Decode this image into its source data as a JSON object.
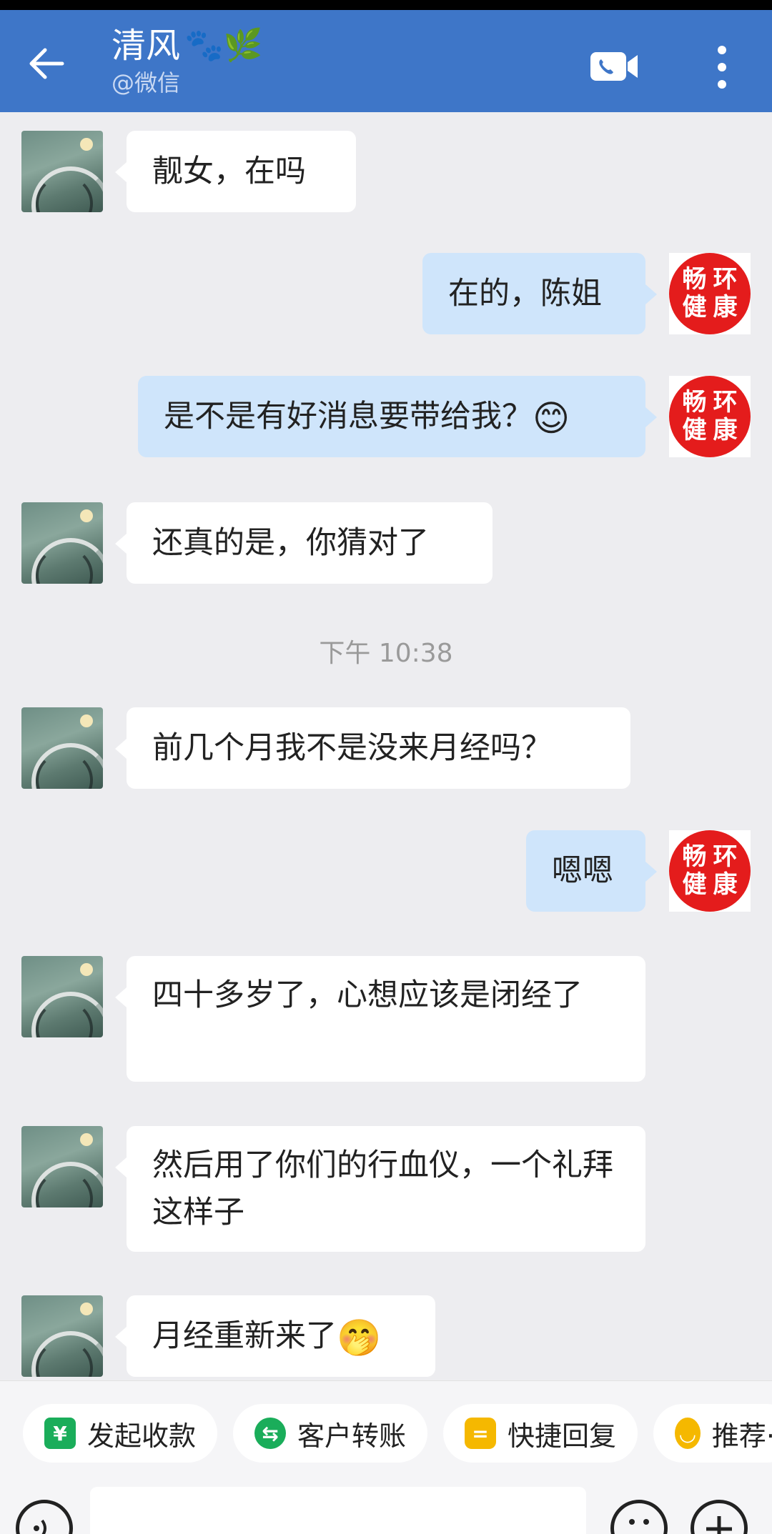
{
  "header": {
    "title": "清风",
    "title_emojis": "🐾🌿",
    "subtitle": "@微信"
  },
  "contact_avatar_seal": [
    "畅",
    "环",
    "健",
    "康"
  ],
  "messages": [
    {
      "side": "in",
      "text": "靓女，在吗"
    },
    {
      "side": "out",
      "text": "在的，陈姐"
    },
    {
      "side": "out",
      "text": "是不是有好消息要带给我？",
      "emoji": "😊"
    },
    {
      "side": "in",
      "text": "还真的是，你猜对了"
    },
    {
      "side": "in",
      "text": "前几个月我不是没来月经吗？"
    },
    {
      "side": "out",
      "text": "嗯嗯"
    },
    {
      "side": "in",
      "text": "四十多岁了，心想应该是闭经了"
    },
    {
      "side": "in",
      "text": "然后用了你们的行血仪，一个礼拜这样子"
    },
    {
      "side": "in",
      "text": "月经重新来了",
      "emoji": "🤭"
    }
  ],
  "timestamp": "下午 10:38",
  "quick_actions": [
    {
      "label": "发起收款",
      "icon": "¥",
      "color": "#1aad5a"
    },
    {
      "label": "客户转账",
      "icon": "⇆",
      "color": "#1aad5a"
    },
    {
      "label": "快捷回复",
      "icon": "=",
      "color": "#f5b800"
    },
    {
      "label": "推荐·",
      "icon": "◡",
      "color": "#f5b800"
    }
  ],
  "colors": {
    "header": "#3e76c8",
    "bubble_out": "#cfe5fb",
    "bubble_in": "#ffffff",
    "seal": "#e41c1c"
  }
}
